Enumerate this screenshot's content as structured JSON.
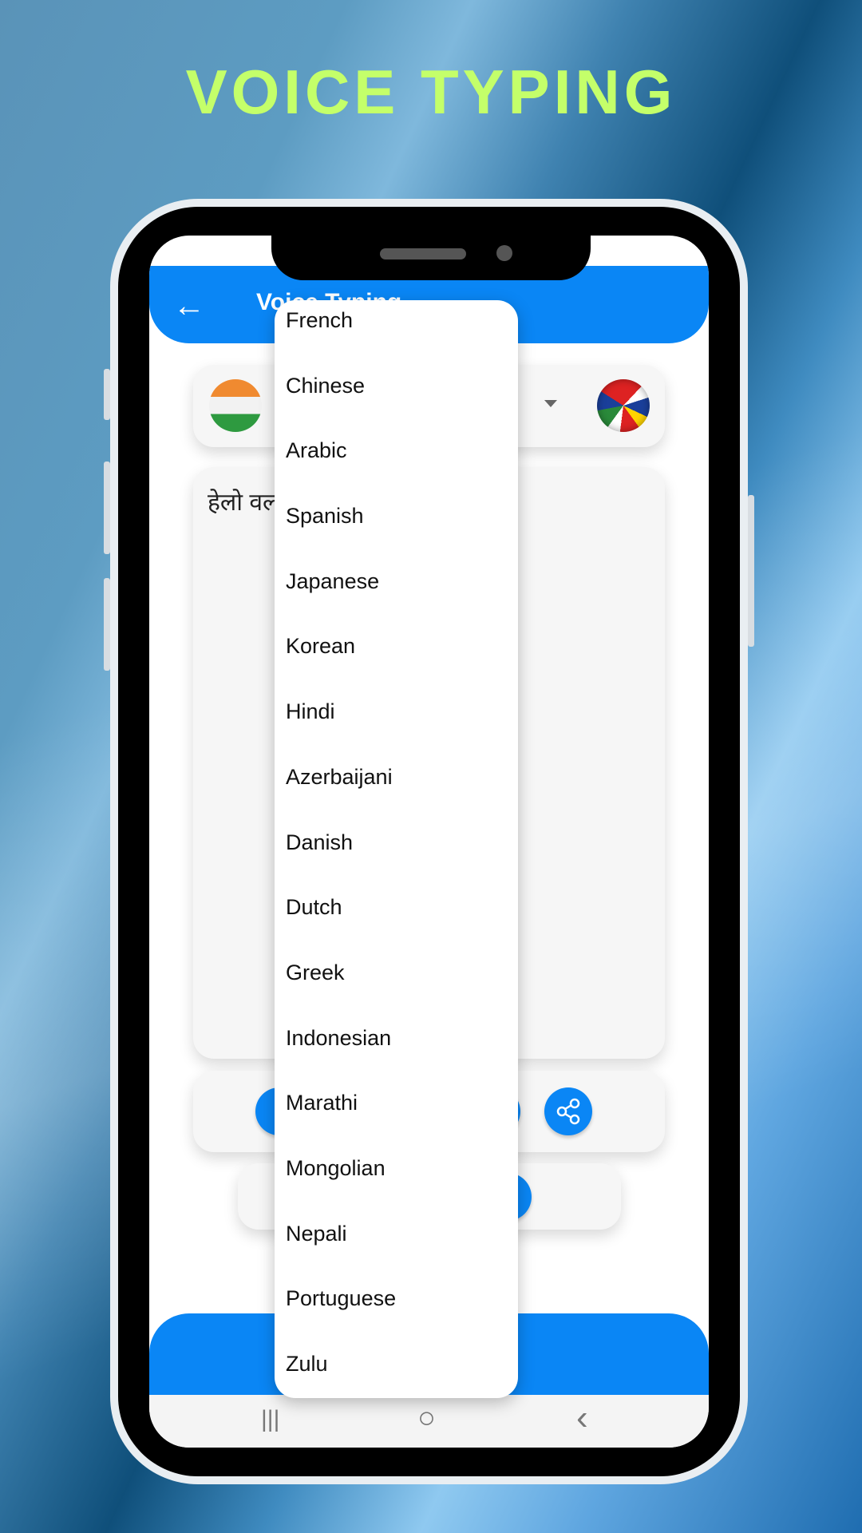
{
  "headline": "VOICE TYPING",
  "app": {
    "title": "Voice Typing",
    "input_text": "हेलो वर्ल्ड",
    "source_flag": "india-flag-icon",
    "target_flag": "world-flags-globe-icon",
    "accent_color": "#0a86f5"
  },
  "dropdown": {
    "items": [
      "French",
      "Chinese",
      "Arabic",
      "Spanish",
      "Japanese",
      "Korean",
      "Hindi",
      "Azerbaijani",
      "Danish",
      "Dutch",
      "Greek",
      "Indonesian",
      "Marathi",
      "Mongolian",
      "Nepali",
      "Portuguese",
      "Zulu"
    ]
  },
  "navbar": {
    "recents": "|||",
    "home": "○",
    "back": "‹"
  }
}
